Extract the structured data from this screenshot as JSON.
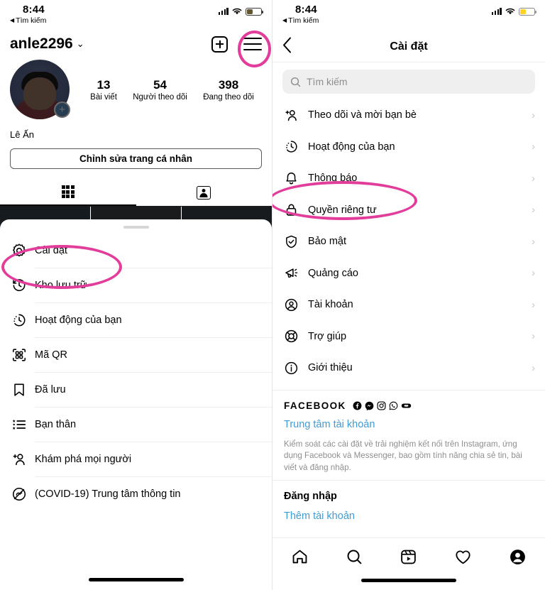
{
  "status_bar": {
    "time": "8:44",
    "back_label": "Tìm kiếm",
    "back_arrow": "◀"
  },
  "accent_pink": "#e23d9b",
  "link_blue": "#3f9bd6",
  "left_panel": {
    "profile": {
      "username": "anle2296",
      "username_chevron": "⌄",
      "full_name": "Lê Ấn",
      "edit_button": "Chỉnh sửa trang cá nhân",
      "add_badge": "+",
      "stats": [
        {
          "value": "13",
          "label": "Bài viết"
        },
        {
          "value": "54",
          "label": "Người theo dõi"
        },
        {
          "value": "398",
          "label": "Đang theo dõi"
        }
      ],
      "tabs": [
        {
          "icon": "grid-icon",
          "name": "posts-grid-tab",
          "active": true
        },
        {
          "icon": "tagged-icon",
          "name": "tagged-tab",
          "active": false
        }
      ]
    },
    "header_actions": [
      {
        "icon": "add-post-icon",
        "name": "add-post-button"
      },
      {
        "icon": "hamburger-menu-icon",
        "name": "hamburger-menu-button",
        "highlighted": true
      }
    ],
    "sheet_items": [
      {
        "label": "Cài đặt",
        "icon": "gear-icon",
        "highlighted": true
      },
      {
        "label": "Kho lưu trữ",
        "icon": "archive-clock-icon",
        "highlighted": false
      },
      {
        "label": "Hoạt động của bạn",
        "icon": "activity-clock-icon",
        "highlighted": false
      },
      {
        "label": "Mã QR",
        "icon": "qr-code-icon",
        "highlighted": false
      },
      {
        "label": "Đã lưu",
        "icon": "bookmark-icon",
        "highlighted": false
      },
      {
        "label": "Bạn thân",
        "icon": "close-friends-list-icon",
        "highlighted": false
      },
      {
        "label": "Khám phá mọi người",
        "icon": "discover-people-icon",
        "highlighted": false
      },
      {
        "label": "(COVID-19) Trung tâm thông tin",
        "icon": "covid-info-icon",
        "highlighted": false
      }
    ]
  },
  "right_panel": {
    "nav": {
      "title": "Cài đặt",
      "back_icon": "chevron-left-icon"
    },
    "search": {
      "placeholder": "Tìm kiếm",
      "icon": "search-icon"
    },
    "settings_items": [
      {
        "label": "Theo dõi và mời bạn bè",
        "icon": "add-person-icon",
        "chevron": "›",
        "highlighted": false
      },
      {
        "label": "Hoạt động của bạn",
        "icon": "activity-clock-icon",
        "chevron": "›",
        "highlighted": false
      },
      {
        "label": "Thông báo",
        "icon": "bell-icon",
        "chevron": "›",
        "highlighted": false
      },
      {
        "label": "Quyền riêng tư",
        "icon": "lock-icon",
        "chevron": "›",
        "highlighted": true
      },
      {
        "label": "Bảo mật",
        "icon": "shield-check-icon",
        "chevron": "›",
        "highlighted": false
      },
      {
        "label": "Quảng cáo",
        "icon": "megaphone-icon",
        "chevron": "›",
        "highlighted": false
      },
      {
        "label": "Tài khoản",
        "icon": "account-circle-icon",
        "chevron": "›",
        "highlighted": false
      },
      {
        "label": "Trợ giúp",
        "icon": "lifebuoy-icon",
        "chevron": "›",
        "highlighted": false
      },
      {
        "label": "Giới thiệu",
        "icon": "info-circle-icon",
        "chevron": "›",
        "highlighted": false
      }
    ],
    "facebook_section": {
      "heading": "FACEBOOK",
      "brand_icons": [
        "facebook-icon",
        "messenger-icon",
        "instagram-icon",
        "whatsapp-icon",
        "oculus-icon"
      ],
      "link": "Trung tâm tài khoản",
      "description": "Kiểm soát các cài đặt về trải nghiệm kết nối trên Instagram, ứng dụng Facebook và Messenger, bao gồm tính năng chia sẻ tin, bài viết và đăng nhập."
    },
    "login_section": {
      "heading": "Đăng nhập",
      "link": "Thêm tài khoản"
    },
    "tabbar": [
      {
        "icon": "home-icon",
        "name": "tab-home"
      },
      {
        "icon": "search-icon",
        "name": "tab-search"
      },
      {
        "icon": "reels-icon",
        "name": "tab-reels"
      },
      {
        "icon": "heart-icon",
        "name": "tab-activity"
      },
      {
        "icon": "profile-avatar-icon",
        "name": "tab-profile"
      }
    ]
  }
}
